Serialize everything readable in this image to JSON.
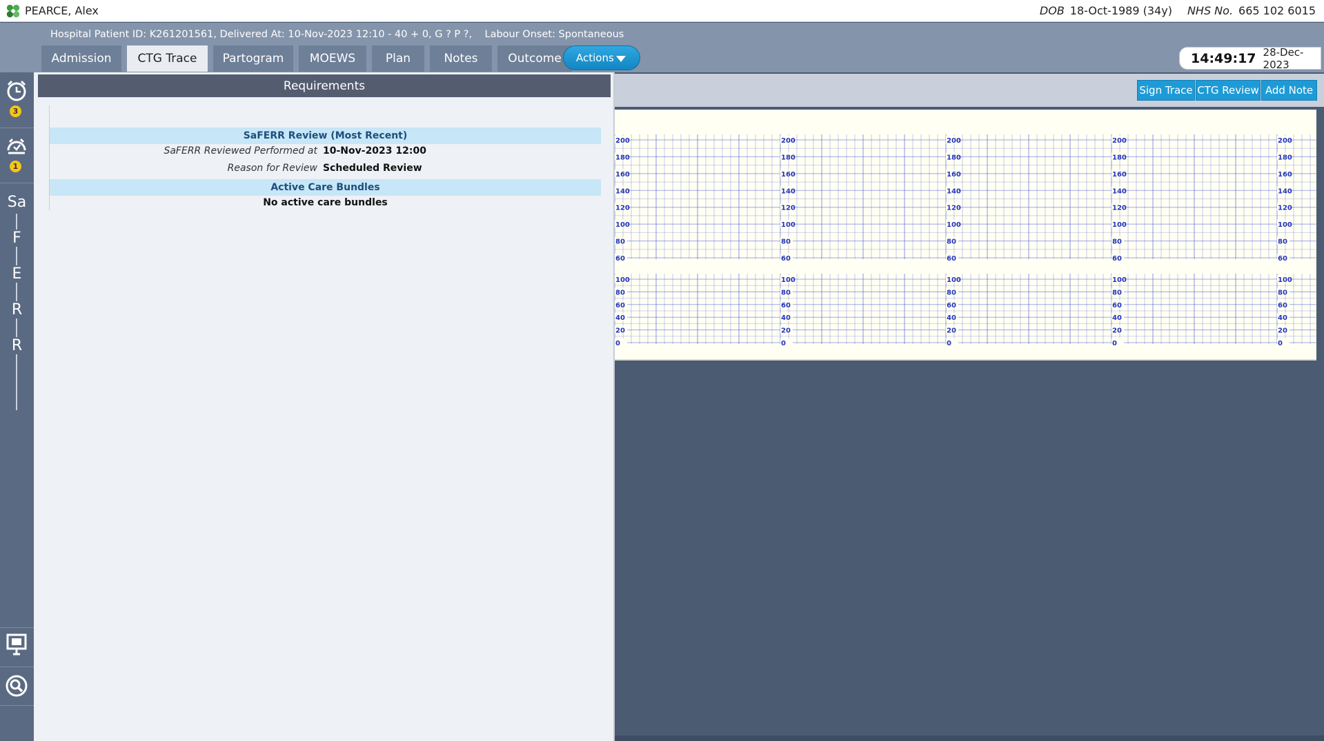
{
  "patient": {
    "name": "PEARCE, Alex",
    "dob_label": "DOB",
    "dob_value": "18-Oct-1989 (34y)",
    "nhs_label": "NHS No.",
    "nhs_value": "665 102 6015",
    "info_line": "Hospital Patient ID: K261201561, Delivered At: 10-Nov-2023 12:10 - 40 + 0, G ? P ?,    Labour Onset: Spontaneous"
  },
  "tabs": [
    {
      "label": "Admission",
      "active": false
    },
    {
      "label": "CTG Trace",
      "active": true
    },
    {
      "label": "Partogram",
      "active": false
    },
    {
      "label": "MOEWS",
      "active": false
    },
    {
      "label": "Plan",
      "active": false
    },
    {
      "label": "Notes",
      "active": false
    },
    {
      "label": "Outcome",
      "active": false
    }
  ],
  "actions_label": "Actions",
  "clock": {
    "time": "14:49:17",
    "date": "28-Dec-2023"
  },
  "sidebar": {
    "alarm_badge": "3",
    "snooze_badge": "1",
    "letters": [
      "Sa",
      "F",
      "E",
      "R",
      "R"
    ],
    "icons": [
      "alarm-clock-icon",
      "snooze-alarm-icon",
      "presentation-board-icon",
      "search-icon"
    ]
  },
  "requirements": {
    "title": "Requirements",
    "saferr_title": "SaFERR Review (Most Recent)",
    "performed_label": "SaFERR Reviewed Performed at",
    "performed_value": "10-Nov-2023 12:00",
    "reason_label": "Reason for Review",
    "reason_value": "Scheduled Review",
    "bundles_title": "Active Care Bundles",
    "bundles_value": "No active care bundles"
  },
  "toolbar": {
    "sign_trace": "Sign Trace",
    "ctg_review": "CTG Review",
    "add_note": "Add Note"
  },
  "ctg": {
    "fhr_scale": [
      "200",
      "180",
      "160",
      "140",
      "120",
      "100",
      "80",
      "60"
    ],
    "toco_scale": [
      "100",
      "80",
      "60",
      "40",
      "20",
      "0"
    ],
    "grid_color": "#2b3fd6"
  },
  "colors": {
    "header_bg": "#8494ab",
    "sidebar_bg": "#5a6a82",
    "accent_button": "#1e9bd7",
    "section_title_bg": "#c7e6f7",
    "badge": "#f5c518"
  }
}
